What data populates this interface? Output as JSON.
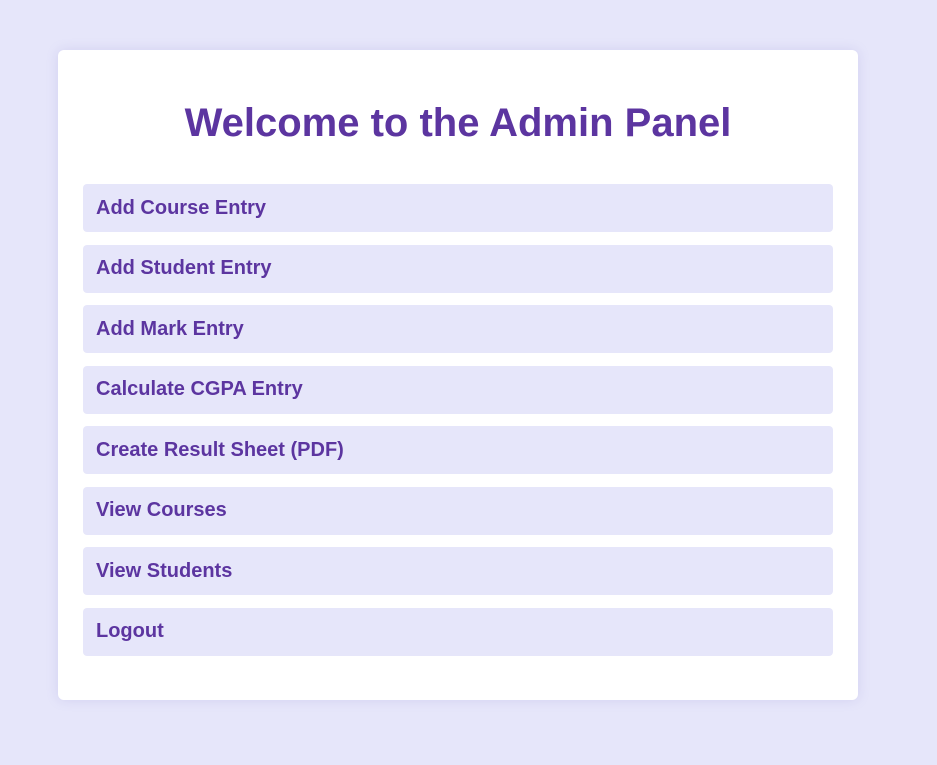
{
  "colors": {
    "page_background": "#e6e6fa",
    "panel_background": "#ffffff",
    "item_background": "#e6e6fa",
    "accent_text": "#5c35a0"
  },
  "panel": {
    "title": "Welcome to the Admin Panel",
    "menu": [
      {
        "label": "Add Course Entry"
      },
      {
        "label": "Add Student Entry"
      },
      {
        "label": "Add Mark Entry"
      },
      {
        "label": "Calculate CGPA Entry"
      },
      {
        "label": "Create Result Sheet (PDF)"
      },
      {
        "label": "View Courses"
      },
      {
        "label": "View Students"
      },
      {
        "label": "Logout"
      }
    ]
  }
}
